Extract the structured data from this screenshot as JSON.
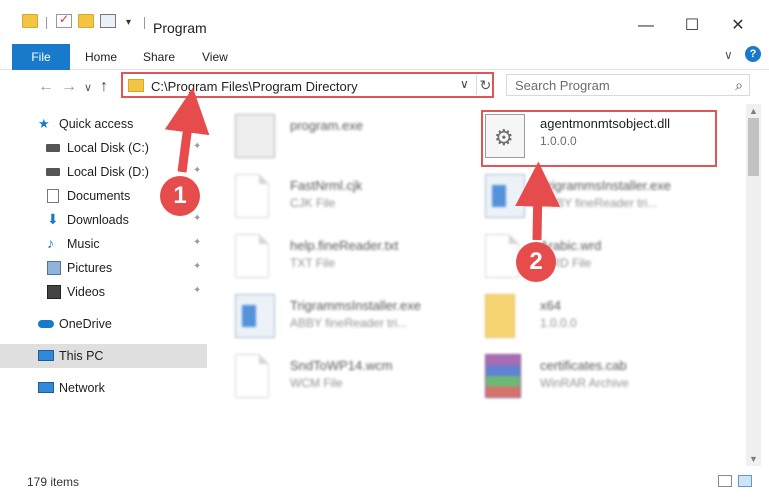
{
  "window": {
    "title": "Program",
    "min": "—",
    "max": "☐",
    "close": "✕"
  },
  "ribbon": {
    "tabs": [
      "File",
      "Home",
      "Share",
      "View"
    ],
    "expand": "∨",
    "help": "?"
  },
  "address": {
    "back": "←",
    "forward": "→",
    "recent": "∨",
    "up": "↑",
    "path": "C:\\Program Files\\Program Directory",
    "dropdown": "∨",
    "refresh": "↻"
  },
  "search": {
    "placeholder": "Search Program",
    "icon": "⌕"
  },
  "sidebar": {
    "items": [
      {
        "label": "Quick access",
        "icon": "star-icon"
      },
      {
        "label": "Local Disk (C:)",
        "icon": "drive-icon"
      },
      {
        "label": "Local Disk (D:)",
        "icon": "drive-icon"
      },
      {
        "label": "Documents",
        "icon": "documents-icon"
      },
      {
        "label": "Downloads",
        "icon": "download-icon"
      },
      {
        "label": "Music",
        "icon": "music-icon"
      },
      {
        "label": "Pictures",
        "icon": "pictures-icon"
      },
      {
        "label": "Videos",
        "icon": "videos-icon"
      },
      {
        "label": "OneDrive",
        "icon": "cloud-icon"
      },
      {
        "label": "This PC",
        "icon": "computer-icon"
      },
      {
        "label": "Network",
        "icon": "network-icon"
      }
    ],
    "pin": "📌"
  },
  "files": [
    {
      "name": "program.exe",
      "desc": "",
      "icon": "exe-icon"
    },
    {
      "name": "agentmonmtsobject.dll",
      "desc": "1.0.0.0",
      "icon": "dll-icon"
    },
    {
      "name": "FastNrml.cjk",
      "desc": "CJK File",
      "icon": "document-icon"
    },
    {
      "name": "TrigrammsInstaller.exe",
      "desc": "ABBY fineReader tri...",
      "icon": "app-window-icon"
    },
    {
      "name": "help.fineReader.txt",
      "desc": "TXT File",
      "icon": "document-icon"
    },
    {
      "name": "Arabic.wrd",
      "desc": "WRD File",
      "icon": "document-icon"
    },
    {
      "name": "TrigrammsInstaller.exe",
      "desc": "ABBY fineReader tri...",
      "icon": "app-window-icon"
    },
    {
      "name": "x64",
      "desc": "1.0.0.0",
      "icon": "folder-icon"
    },
    {
      "name": "SndToWP14.wcm",
      "desc": "WCM File",
      "icon": "document-icon"
    },
    {
      "name": "certificates.cab",
      "desc": "WinRAR Archive",
      "icon": "winrar-icon"
    }
  ],
  "status": {
    "items_count": "179 items"
  },
  "annotations": {
    "step1": "1",
    "step2": "2",
    "color": "#e74c4c"
  }
}
